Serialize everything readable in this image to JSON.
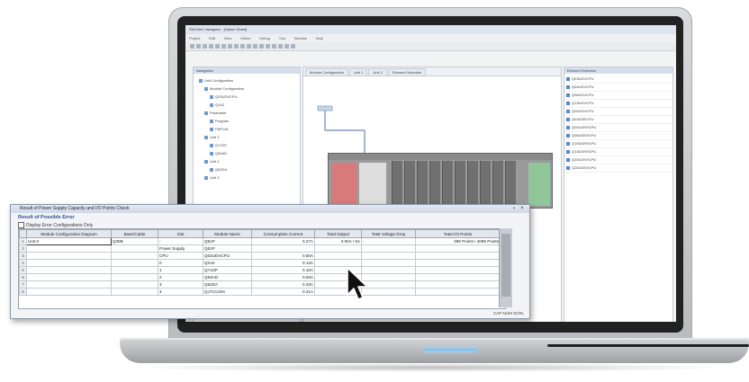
{
  "ide": {
    "title": "SW1Ver1 Navigator - [Option Sheet]",
    "menus": [
      "Project",
      "Edit",
      "View",
      "Online",
      "Debug",
      "Tool",
      "Window",
      "Help"
    ],
    "nav_title": "Navigation",
    "nav_items": [
      "Unit Configuration",
      "Module Configuration",
      "Parameter",
      "Program",
      "FB/FUN",
      "Label",
      "Device Memory",
      "Unit 1",
      "Unit 2",
      "Unit 3",
      "Q03UDVCPU",
      "QX42",
      "QY42P",
      "Q64AD",
      "Q62DA"
    ],
    "tabs": [
      "Module Configuration",
      "Unit 1",
      "Unit 2",
      "Element Selection"
    ],
    "props_title": "Element Selection",
    "props_items": [
      "Q03UDVCPU",
      "Q04UDVCPU",
      "Q06UDVCPU",
      "Q13UDVCPU",
      "Q26UDVCPU",
      "Q03UDECPU",
      "Q04UDEHCPU",
      "Q06UDEHCPU",
      "Q10UDEHCPU",
      "Q13UDEHCPU",
      "Q20UDEHCPU",
      "Q26UDEHCPU"
    ]
  },
  "dialog": {
    "title": "Result of Power Supply Capacity and I/O Points Check",
    "pin": "▪",
    "close": "×",
    "result_label": "Result of Possible Error",
    "checkbox_label": "Display Error Configurations Only",
    "columns": [
      "Module Configuration Diagram",
      "Base/Cable",
      "Slot",
      "Module Name",
      "Consumption Current",
      "Total Output",
      "Total Voltage Drop",
      "Total I/O Points"
    ],
    "rows": [
      [
        "Unit 0",
        "Q35B",
        "-",
        "Q61P",
        "0.27A",
        "3.00A / 6A",
        "-",
        "288 Points / 4096 Points"
      ],
      [
        "",
        "",
        "Power Supply",
        "Q61P",
        "",
        "",
        "",
        ""
      ],
      [
        "",
        "",
        "CPU",
        "Q03UDVCPU",
        "0.60A",
        "",
        "",
        ""
      ],
      [
        "",
        "",
        "0",
        "QX42",
        "0.13A",
        "",
        "",
        ""
      ],
      [
        "",
        "",
        "1",
        "QY42P",
        "0.10A",
        "",
        "",
        ""
      ],
      [
        "",
        "",
        "2",
        "Q64AD",
        "0.63A",
        "",
        "",
        ""
      ],
      [
        "",
        "",
        "3",
        "Q62DA",
        "0.33A",
        "",
        "",
        ""
      ],
      [
        "",
        "",
        "4",
        "QJ71C24N",
        "0.31A",
        "",
        "",
        ""
      ]
    ],
    "status": "CAP  NUM  SCRL"
  },
  "colors": {
    "accent": "#2d4f9b",
    "rack_red": "#d97a7a",
    "rack_green": "#8fc79b"
  }
}
